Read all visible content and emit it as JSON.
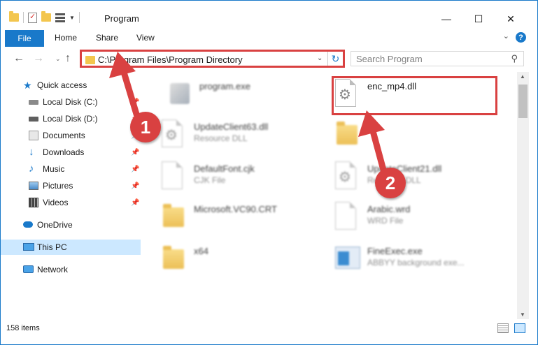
{
  "window": {
    "title": "Program",
    "controls": {
      "minimize": "—",
      "maximize": "☐",
      "close": "✕"
    }
  },
  "ribbon": {
    "tabs": [
      "File",
      "Home",
      "Share",
      "View"
    ],
    "help": "?"
  },
  "address": {
    "path": "C:\\Program Files\\Program Directory",
    "refresh": "↻"
  },
  "search": {
    "placeholder": "Search Program"
  },
  "nav": {
    "items": [
      {
        "label": "Quick access",
        "icon": "star-icon"
      },
      {
        "label": "Local Disk (C:)",
        "icon": "drive-icon"
      },
      {
        "label": "Local Disk (D:)",
        "icon": "drive-icon"
      },
      {
        "label": "Documents",
        "icon": "documents-icon"
      },
      {
        "label": "Downloads",
        "icon": "download-icon"
      },
      {
        "label": "Music",
        "icon": "music-icon"
      },
      {
        "label": "Pictures",
        "icon": "pictures-icon"
      },
      {
        "label": "Videos",
        "icon": "videos-icon"
      },
      {
        "label": "OneDrive",
        "icon": "cloud-icon"
      },
      {
        "label": "This PC",
        "icon": "pc-icon"
      },
      {
        "label": "Network",
        "icon": "network-icon"
      }
    ]
  },
  "files": [
    {
      "name": "program.exe",
      "type": "",
      "icon": "program-icon"
    },
    {
      "name": "enc_mp4.dll",
      "type": "",
      "icon": "gear-file-icon"
    },
    {
      "name": "UpdateClient63.dll",
      "type": "Resource DLL",
      "icon": "gear-file-icon"
    },
    {
      "name": "",
      "type": "",
      "icon": "folder-icon"
    },
    {
      "name": "DefaultFont.cjk",
      "type": "CJK File",
      "icon": "file-icon"
    },
    {
      "name": "UpdateClient21.dll",
      "type": "Resource DLL",
      "icon": "gear-file-icon"
    },
    {
      "name": "Microsoft.VC90.CRT",
      "type": "",
      "icon": "folder-icon"
    },
    {
      "name": "Arabic.wrd",
      "type": "WRD File",
      "icon": "file-icon"
    },
    {
      "name": "x64",
      "type": "",
      "icon": "folder-icon"
    },
    {
      "name": "FineExec.exe",
      "type": "ABBYY background exe...",
      "icon": "exe-icon"
    }
  ],
  "status": {
    "item_count": "158 items"
  },
  "annotations": {
    "badge1": "1",
    "badge2": "2"
  },
  "colors": {
    "accent": "#1979ca",
    "annotation_red": "#d94141",
    "folder": "#f3c64e",
    "selected": "#cce8ff"
  }
}
